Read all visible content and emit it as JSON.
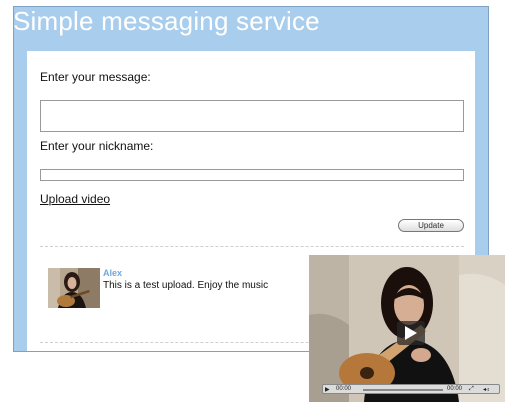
{
  "app": {
    "title": "Simple messaging service"
  },
  "form": {
    "message_label": "Enter your message:",
    "message_value": "",
    "nickname_label": "Enter your nickname:",
    "nickname_value": "",
    "upload_link": "Upload video",
    "update_button": "Update"
  },
  "posts": [
    {
      "author": "Alex",
      "text": "This is a test upload. Enjoy the music"
    }
  ],
  "video": {
    "time_elapsed": "00:00",
    "time_total": "00:00",
    "icons": [
      "play-icon",
      "fullscreen-icon",
      "volume-icon"
    ]
  }
}
